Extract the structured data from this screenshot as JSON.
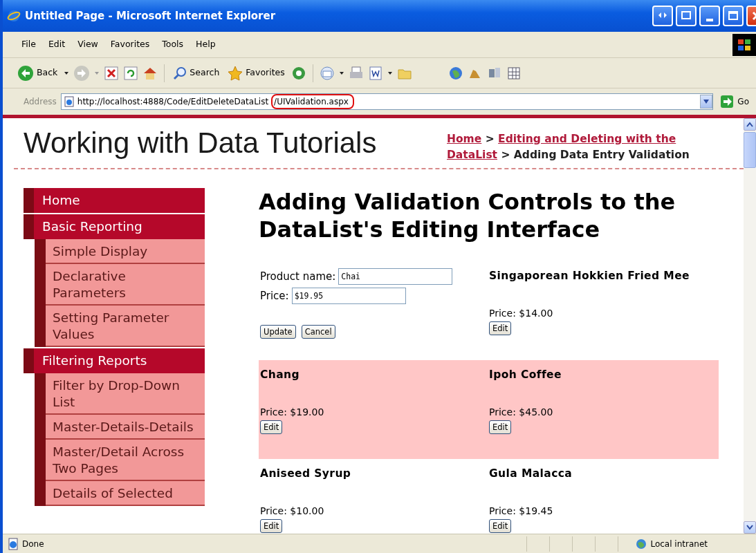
{
  "window": {
    "title": "Untitled Page - Microsoft Internet Explorer"
  },
  "menu": [
    "File",
    "Edit",
    "View",
    "Favorites",
    "Tools",
    "Help"
  ],
  "toolbar": {
    "back": "Back",
    "search": "Search",
    "favorites": "Favorites"
  },
  "address_bar": {
    "label": "Address",
    "url": "http://localhost:4888/Code/EditDeleteDataList",
    "url_highlighted": "/UIValidation.aspx",
    "go": "Go"
  },
  "page": {
    "site_title": "Working with Data Tutorials",
    "breadcrumb": [
      {
        "kind": "link",
        "text": "Home"
      },
      {
        "kind": "separator",
        "text": ">"
      },
      {
        "kind": "link",
        "text": "Editing and Deleting with the DataList"
      },
      {
        "kind": "separator",
        "text": ">"
      },
      {
        "kind": "current",
        "text": "Adding Data Entry Validation"
      }
    ],
    "sidebar": [
      {
        "label": "Home"
      },
      {
        "label": "Basic Reporting",
        "children": [
          {
            "label": "Simple Display"
          },
          {
            "label": "Declarative Parameters"
          },
          {
            "label": "Setting Parameter Values"
          }
        ]
      },
      {
        "label": "Filtering Reports",
        "children": [
          {
            "label": "Filter by Drop-Down List"
          },
          {
            "label": "Master-Details-Details"
          },
          {
            "label": "Master/Detail Across Two Pages"
          },
          {
            "label": "Details of Selected"
          }
        ]
      }
    ],
    "heading": "Adding Validation Controls to the DataList's Editing Interface",
    "data_list": {
      "rows": [
        {
          "shaded": false,
          "items": [
            {
              "kind": "edit",
              "fields": [
                {
                  "label": "Product name:",
                  "value": "Chai"
                },
                {
                  "label": "Price:",
                  "value": "$19.95"
                }
              ],
              "buttons": [
                "Update",
                "Cancel"
              ]
            },
            {
              "kind": "view",
              "name": "Singaporean Hokkien Fried Mee",
              "price": "Price: $14.00",
              "button": "Edit"
            }
          ]
        },
        {
          "shaded": true,
          "items": [
            {
              "kind": "view",
              "name": "Chang",
              "price": "Price: $19.00",
              "button": "Edit"
            },
            {
              "kind": "view",
              "name": "Ipoh Coffee",
              "price": "Price: $45.00",
              "button": "Edit"
            }
          ]
        },
        {
          "shaded": false,
          "items": [
            {
              "kind": "view",
              "name": "Aniseed Syrup",
              "price": "Price: $10.00",
              "button": "Edit"
            },
            {
              "kind": "view",
              "name": "Gula Malacca",
              "price": "Price: $19.45",
              "button": "Edit"
            }
          ]
        }
      ]
    }
  },
  "status_bar": {
    "status": "Done",
    "zone": "Local intranet"
  }
}
